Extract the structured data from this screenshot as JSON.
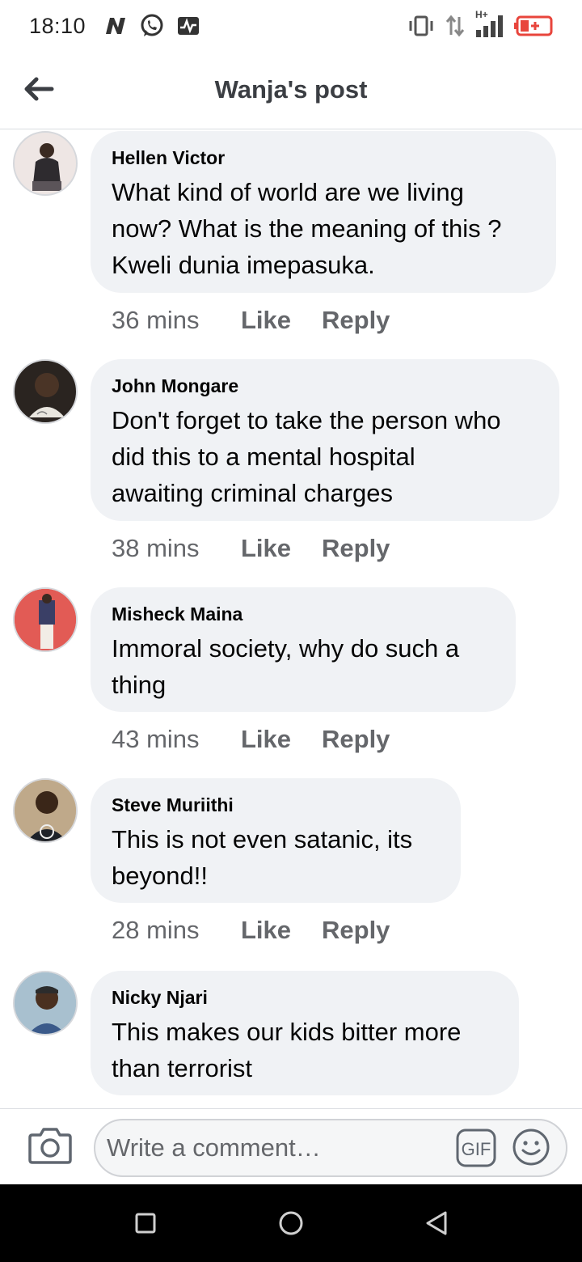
{
  "status_bar": {
    "time": "18:10",
    "left_icons": [
      "n-icon",
      "whatsapp-icon",
      "activity-icon"
    ],
    "right_icons": [
      "vibrate-icon",
      "data-arrows-icon",
      "signal-icon",
      "battery-icon"
    ],
    "network_label": "H+"
  },
  "header": {
    "title": "Wanja's post"
  },
  "comments": [
    {
      "author": "Hellen Victor",
      "lines": [
        "What kind of world are we living",
        "now? What is the meaning of this ?",
        "Kweli dunia imepasuka."
      ],
      "time": "36 mins",
      "like": "Like",
      "reply": "Reply"
    },
    {
      "author": "John Mongare",
      "lines": [
        "Don't forget to take the person who",
        "did this to a mental hospital",
        "awaiting criminal charges"
      ],
      "time": "38 mins",
      "like": "Like",
      "reply": "Reply"
    },
    {
      "author": "Misheck Maina",
      "lines": [
        "Immoral society, why do such a",
        "thing"
      ],
      "time": "43 mins",
      "like": "Like",
      "reply": "Reply"
    },
    {
      "author": "Steve Muriithi",
      "lines": [
        "This is not even satanic, its",
        "beyond!!"
      ],
      "time": "28 mins",
      "like": "Like",
      "reply": "Reply"
    },
    {
      "author": "Nicky Njari",
      "lines": [
        "This makes our kids bitter more",
        "than terrorist"
      ],
      "time": "",
      "like": "",
      "reply": ""
    }
  ],
  "composer": {
    "placeholder": "Write a comment…",
    "gif_label": "GIF"
  },
  "colors": {
    "bubble": "#f0f2f5",
    "secondary_text": "#65676b",
    "battery_red": "#e8453c"
  }
}
